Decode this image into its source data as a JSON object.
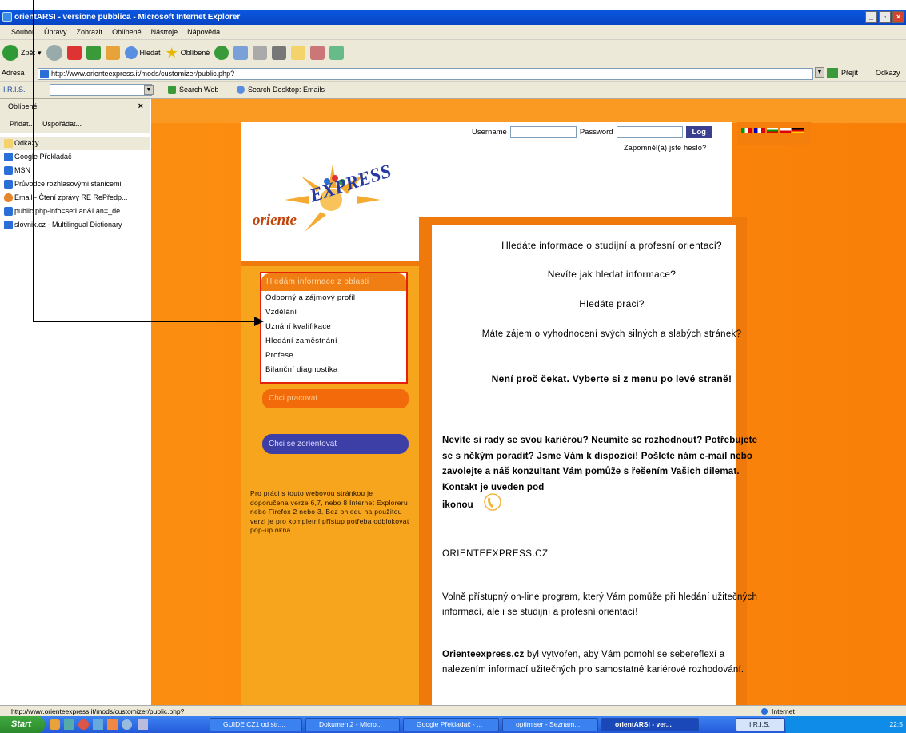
{
  "window": {
    "title": "orientARSI - versione pubblica - Microsoft Internet Explorer"
  },
  "menubar": [
    "Soubor",
    "Úpravy",
    "Zobrazit",
    "Oblíbené",
    "Nástroje",
    "Nápověda"
  ],
  "toolbar": {
    "back": "Zpět",
    "search": "Hledat",
    "favorites": "Oblíbené"
  },
  "address": {
    "label": "Adresa",
    "url": "http://www.orienteexpress.it/mods/customizer/public.php?",
    "go": "Přejít",
    "links": "Odkazy"
  },
  "iris": {
    "label": "I.R.I.S.",
    "search_web": "Search Web",
    "search_desktop": "Search Desktop: Emails"
  },
  "sidebar": {
    "title": "Oblíbené",
    "close": "×",
    "add": "Přidat...",
    "organize": "Uspořádat...",
    "items": [
      "Odkazy",
      "Google Překladač",
      "MSN",
      "Průvodce rozhlasovými stanicemi",
      "Email - Čtení zprávy RE RePředp...",
      "public.php-info=setLan&Lan=_de",
      "slovnik.cz - Multilingual Dictionary"
    ]
  },
  "login": {
    "username": "Username",
    "password": "Password",
    "button": "Log",
    "forgot": "Zapomněl(a) jste heslo?"
  },
  "logo": {
    "part1": "oriente",
    "part2": "EXPRESS"
  },
  "leftmenu": {
    "header": "Hledám informace z oblasti",
    "items": [
      "Odborný a zájmový profil",
      "Vzdělání",
      "Uznání kvalifikace",
      "Hledání zaměstnání",
      "Profese",
      "Bilanční diagnostika"
    ]
  },
  "buttons": {
    "work": "Chci pracovat",
    "orient": "Chci se zorientovat"
  },
  "note": "Pro práci s touto webovou stránkou je doporučena verze 6,7, nebo 8 Internet Exploreru nebo Firefox 2 nebo 3. Bez ohledu na použitou verzi je pro kompletní přístup potřeba odblokovat pop-up okna.",
  "main": {
    "q1": "Hledáte informace o studijní a profesní orientaci?",
    "q2": "Nevíte jak hledat informace?",
    "q3": "Hledáte práci?",
    "q4": "Máte zájem o vyhodnocení svých silných a slabých stránek?",
    "q5": "Není proč čekat. Vyberte si z menu po levé straně!",
    "p1": "Nevíte si rady se svou kariérou? Neumíte se rozhodnout? Potřebujete se s někým poradit? Jsme Vám k dispozici! Pošlete nám e-mail nebo zavolejte a náš konzultant Vám pomůže s řešením Vašich dilemat. Kontakt je uveden pod",
    "p1b": "ikonou",
    "site": "ORIENTEEXPRESS.CZ",
    "p2": "Volně přístupný on-line program, který Vám pomůže při hledání užitečných informací, ale i se studijní a profesní orientací!",
    "p3a": "Orienteexpress.cz",
    "p3b": " byl vytvořen, aby Vám pomohl se sebereflexí a nalezením informací užitečných pro samostatné kariérové rozhodování."
  },
  "status": {
    "url": "http://www.orienteexpress.it/mods/customizer/public.php?",
    "zone": "Internet"
  },
  "taskbar": {
    "start": "Start",
    "tasks": [
      "GUIDE CZ1 od str....",
      "Dokument2 - Micro...",
      "Google Překladač - ...",
      "optimiser - Seznam...",
      "orientARSI - ver...",
      "I.R.I.S."
    ],
    "clock": "22:5"
  }
}
